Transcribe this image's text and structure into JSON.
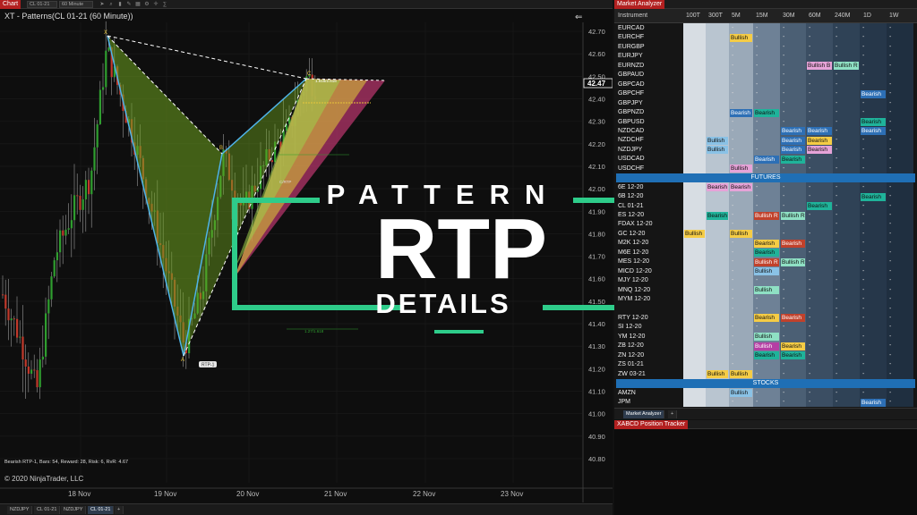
{
  "chart": {
    "window_tag": "Chart",
    "instrument": "CL 01-21",
    "interval": "60 Minute",
    "title": "XT - Patterns(CL 01-21 (60 Minute))",
    "price_labels": [
      "42.70",
      "42.60",
      "42.50",
      "42.40",
      "42.30",
      "42.20",
      "42.10",
      "42.00",
      "41.90",
      "41.80",
      "41.70",
      "41.60",
      "41.50",
      "41.40",
      "41.30",
      "41.20",
      "41.10",
      "41.00",
      "40.90",
      "40.80"
    ],
    "current_price": "42.47",
    "date_labels": [
      "18 Nov",
      "19 Nov",
      "20 Nov",
      "21 Nov",
      "22 Nov",
      "23 Nov"
    ],
    "point_labels": [
      "X",
      "A",
      "B",
      "C"
    ],
    "pattern_tag": "RTP-1",
    "pattern_note": "Bearish RTP-1, Bars: 54, Reward: 28, Risk: 6, RvR: 4.67",
    "copyright": "© 2020 NinjaTrader, LLC",
    "small_tags": [
      "1.618/2.618",
      "1.27/1.618",
      "C/RTP"
    ],
    "colors": {
      "pattern_green": "#6ea31f",
      "pattern_pink": "#b3346a",
      "pattern_yellow": "#d8c23a",
      "bull": "#2f9e2f",
      "bear": "#c0392b",
      "wick": "#9a9a9a"
    }
  },
  "chart_tabs": [
    "NZDJPY",
    "CL 01-21",
    "NZDJPY",
    "CL 01-21",
    "+"
  ],
  "overlay": {
    "line1": "PATTERN",
    "line2": "RTP",
    "line3": "DETAILS",
    "accent": "#2ecc8a"
  },
  "analyzer": {
    "window_tag": "Market Analyzer",
    "headers": [
      "Instrument",
      "100T",
      "300T",
      "5M",
      "15M",
      "30M",
      "60M",
      "240M",
      "1D",
      "1W"
    ],
    "rows": [
      {
        "name": "EURCAD",
        "type": "row"
      },
      {
        "name": "EURCHF",
        "type": "row"
      },
      {
        "name": "EURGBP",
        "type": "row"
      },
      {
        "name": "EURJPY",
        "type": "row"
      },
      {
        "name": "EURNZD",
        "type": "row"
      },
      {
        "name": "GBPAUD",
        "type": "row"
      },
      {
        "name": "GBPCAD",
        "type": "row"
      },
      {
        "name": "GBPCHF",
        "type": "row"
      },
      {
        "name": "GBPJPY",
        "type": "row"
      },
      {
        "name": "GBPNZD",
        "type": "row"
      },
      {
        "name": "GBPUSD",
        "type": "row"
      },
      {
        "name": "NZDCAD",
        "type": "row"
      },
      {
        "name": "NZDCHF",
        "type": "row"
      },
      {
        "name": "NZDJPY",
        "type": "row"
      },
      {
        "name": "USDCAD",
        "type": "row"
      },
      {
        "name": "USDCHF",
        "type": "row"
      },
      {
        "name": "FUTURES",
        "type": "section"
      },
      {
        "name": "6E 12-20",
        "type": "row"
      },
      {
        "name": "6B 12-20",
        "type": "row"
      },
      {
        "name": "CL 01-21",
        "type": "row"
      },
      {
        "name": "ES 12-20",
        "type": "row"
      },
      {
        "name": "FDAX 12-20",
        "type": "row"
      },
      {
        "name": "GC 12-20",
        "type": "row"
      },
      {
        "name": "M2K 12-20",
        "type": "row"
      },
      {
        "name": "M6E 12-20",
        "type": "row"
      },
      {
        "name": "MES 12-20",
        "type": "row"
      },
      {
        "name": "MICD 12-20",
        "type": "row"
      },
      {
        "name": "MJY 12-20",
        "type": "row"
      },
      {
        "name": "MNQ 12-20",
        "type": "row"
      },
      {
        "name": "MYM 12-20",
        "type": "row"
      },
      {
        "name": "",
        "type": "row"
      },
      {
        "name": "RTY 12-20",
        "type": "row"
      },
      {
        "name": "SI 12-20",
        "type": "row"
      },
      {
        "name": "YM 12-20",
        "type": "row"
      },
      {
        "name": "ZB 12-20",
        "type": "row"
      },
      {
        "name": "ZN 12-20",
        "type": "row"
      },
      {
        "name": "ZS 01-21",
        "type": "row"
      },
      {
        "name": "ZW 03-21",
        "type": "row"
      },
      {
        "name": "STOCKS",
        "type": "section"
      },
      {
        "name": "AMZN",
        "type": "row"
      },
      {
        "name": "JPM",
        "type": "row"
      }
    ],
    "signals": [
      {
        "row": 1,
        "col": 3,
        "text": "Bullish",
        "style": "bullish"
      },
      {
        "row": 4,
        "col": 6,
        "text": "Bullish B",
        "style": "pink"
      },
      {
        "row": 4,
        "col": 7,
        "text": "Bullish R",
        "style": "mint"
      },
      {
        "row": 7,
        "col": 8,
        "text": "Bearish",
        "style": "bearish"
      },
      {
        "row": 9,
        "col": 3,
        "text": "Bearish",
        "style": "bearish"
      },
      {
        "row": 9,
        "col": 4,
        "text": "Bearish",
        "style": "teal"
      },
      {
        "row": 10,
        "col": 8,
        "text": "Bearish",
        "style": "teal"
      },
      {
        "row": 11,
        "col": 5,
        "text": "Bearish",
        "style": "bearish"
      },
      {
        "row": 11,
        "col": 6,
        "text": "Bearish",
        "style": "bearish"
      },
      {
        "row": 11,
        "col": 8,
        "text": "Bearish",
        "style": "bearish"
      },
      {
        "row": 12,
        "col": 2,
        "text": "Bullish",
        "style": "lblue"
      },
      {
        "row": 12,
        "col": 5,
        "text": "Bearish",
        "style": "bearish"
      },
      {
        "row": 12,
        "col": 6,
        "text": "Bearish",
        "style": "bullish"
      },
      {
        "row": 13,
        "col": 2,
        "text": "Bullish",
        "style": "lblue"
      },
      {
        "row": 13,
        "col": 5,
        "text": "Bearish",
        "style": "bearish"
      },
      {
        "row": 13,
        "col": 6,
        "text": "Bearish",
        "style": "pink"
      },
      {
        "row": 14,
        "col": 4,
        "text": "Bearish",
        "style": "bearish"
      },
      {
        "row": 14,
        "col": 5,
        "text": "Bearish",
        "style": "teal"
      },
      {
        "row": 15,
        "col": 3,
        "text": "Bullish",
        "style": "pink"
      },
      {
        "row": 17,
        "col": 2,
        "text": "Bearish",
        "style": "pink"
      },
      {
        "row": 17,
        "col": 3,
        "text": "Bearish",
        "style": "pink"
      },
      {
        "row": 18,
        "col": 8,
        "text": "Bearish",
        "style": "teal"
      },
      {
        "row": 19,
        "col": 6,
        "text": "Bearish",
        "style": "teal"
      },
      {
        "row": 20,
        "col": 2,
        "text": "Bearish",
        "style": "teal"
      },
      {
        "row": 20,
        "col": 4,
        "text": "Bullish R",
        "style": "red"
      },
      {
        "row": 20,
        "col": 5,
        "text": "Bullish R",
        "style": "mint"
      },
      {
        "row": 22,
        "col": 1,
        "text": "Bullish",
        "style": "bullish"
      },
      {
        "row": 22,
        "col": 3,
        "text": "Bullish",
        "style": "bullish"
      },
      {
        "row": 23,
        "col": 4,
        "text": "Bearish",
        "style": "bullish"
      },
      {
        "row": 23,
        "col": 5,
        "text": "Bearish",
        "style": "red"
      },
      {
        "row": 24,
        "col": 4,
        "text": "Bearish",
        "style": "teal"
      },
      {
        "row": 25,
        "col": 4,
        "text": "Bullish R",
        "style": "red"
      },
      {
        "row": 25,
        "col": 5,
        "text": "Bullish R",
        "style": "mint"
      },
      {
        "row": 26,
        "col": 4,
        "text": "Bullish",
        "style": "lblue"
      },
      {
        "row": 28,
        "col": 4,
        "text": "Bullish",
        "style": "mint"
      },
      {
        "row": 31,
        "col": 4,
        "text": "Bearish",
        "style": "bullish"
      },
      {
        "row": 31,
        "col": 5,
        "text": "Bearish",
        "style": "red"
      },
      {
        "row": 33,
        "col": 4,
        "text": "Bullish",
        "style": "mint"
      },
      {
        "row": 34,
        "col": 4,
        "text": "Bullish",
        "style": "violet"
      },
      {
        "row": 34,
        "col": 5,
        "text": "Bearish",
        "style": "bullish"
      },
      {
        "row": 35,
        "col": 4,
        "text": "Bearish",
        "style": "teal"
      },
      {
        "row": 35,
        "col": 5,
        "text": "Bearish",
        "style": "teal"
      },
      {
        "row": 37,
        "col": 2,
        "text": "Bullish",
        "style": "bullish"
      },
      {
        "row": 37,
        "col": 3,
        "text": "Bullish",
        "style": "bullish"
      },
      {
        "row": 39,
        "col": 3,
        "text": "Bullish",
        "style": "lblue"
      },
      {
        "row": 40,
        "col": 8,
        "text": "Bearish",
        "style": "bearish"
      }
    ],
    "tab_label": "Market Analyzer",
    "tab_add": "+"
  },
  "tracker": {
    "window_tag": "XABCD Position Tracker"
  }
}
